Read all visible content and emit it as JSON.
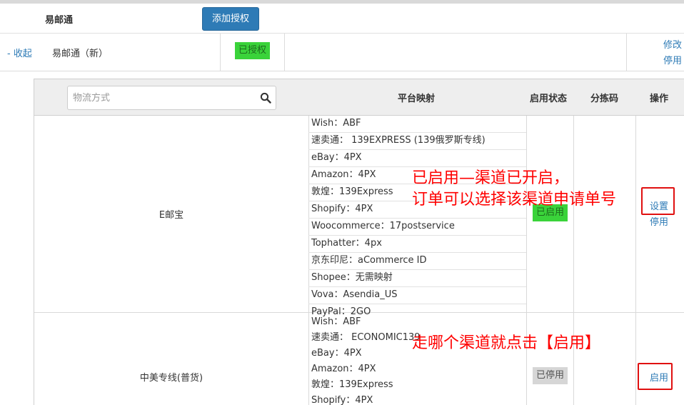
{
  "header": {
    "title": "易邮通",
    "add_auth_button": "添加授权"
  },
  "account": {
    "collapse_link": "- 收起",
    "name": "易邮通（新）",
    "auth_status": "已授权",
    "edit_link": "修改",
    "disable_link": "停用"
  },
  "table": {
    "search_placeholder": "物流方式",
    "columns": {
      "mapping": "平台映射",
      "status": "启用状态",
      "sort_code": "分拣码",
      "action": "操作"
    },
    "rows": [
      {
        "channel": "E邮宝",
        "mappings": [
          "Wish：ABF",
          "速卖通： 139EXPRESS (139俄罗斯专线)",
          "eBay：4PX",
          "Amazon：4PX",
          "敦煌：139Express",
          "Shopify：4PX",
          "Woocommerce：17postservice",
          "Tophatter：4px",
          "京东印尼：aCommerce ID",
          "Shopee：无需映射",
          "Vova：Asendia_US",
          "PayPal：2GO"
        ],
        "status": "已启用",
        "actions": [
          "设置",
          "停用"
        ]
      },
      {
        "channel": "中美专线(普货)",
        "mappings": [
          "Wish：ABF",
          "速卖通： ECONOMIC139",
          "eBay：4PX",
          "Amazon：4PX",
          "敦煌：139Express",
          "Shopify：4PX"
        ],
        "status": "已停用",
        "actions": [
          "启用"
        ]
      }
    ]
  },
  "annotations": {
    "line1": "已启用—渠道已开启，",
    "line2": "订单可以选择该渠道申请单号",
    "line3": "走哪个渠道就点击【启用】"
  },
  "colors": {
    "accent": "#2e7bb6",
    "enabled_badge": "#3ad33a",
    "disabled_badge": "#d6d6d6",
    "annotation": "#ff0000"
  }
}
